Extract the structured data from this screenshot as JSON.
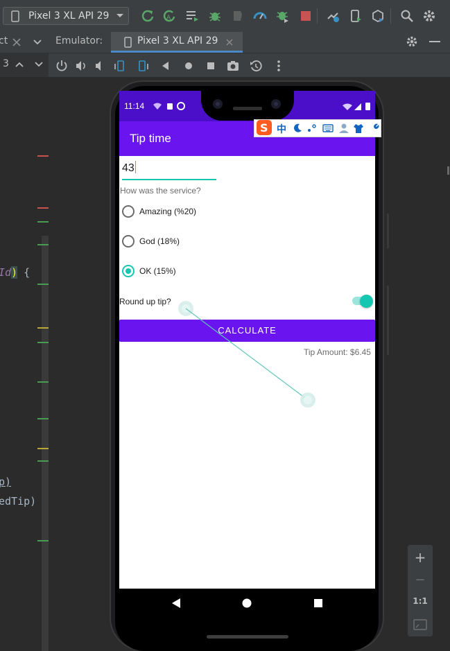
{
  "toolbar": {
    "device_label": "Pixel 3 XL API 29",
    "icons": [
      "device-icon",
      "chevron-down-icon",
      "rerun-icon",
      "apply-changes-icon",
      "apply-code-changes-icon",
      "debug-icon",
      "attach-debugger-icon",
      "profiler-icon",
      "attach-debugger-process-icon",
      "stop-icon",
      "sync-icon",
      "device-manager-icon",
      "sdk-manager-icon",
      "search-icon",
      "settings-icon"
    ],
    "colors": {
      "run_green": "#59a869",
      "stop_red": "#c75450"
    }
  },
  "tabs": {
    "left_partial": "ct",
    "emulator_label": "Emulator:",
    "active_tab": "Pixel 3 XL API 29"
  },
  "controls": {
    "left_partial": "3",
    "icons": [
      "power-icon",
      "volume-up-icon",
      "volume-down-icon",
      "rotate-left-icon",
      "rotate-right-icon",
      "back-icon",
      "home-icon",
      "overview-icon",
      "screenshot-icon",
      "snapshot-icon",
      "more-icon"
    ]
  },
  "editor": {
    "line1": "Id) {",
    "line2": "p)",
    "line3": "edTip)"
  },
  "phone": {
    "status_time": "11:14",
    "app_title": "Tip time",
    "amount_value": "43",
    "service_question": "How was the service?",
    "options": [
      {
        "label": "Amazing (%20)",
        "checked": false
      },
      {
        "label": "God (18%)",
        "checked": false
      },
      {
        "label": "OK (15%)",
        "checked": true
      }
    ],
    "round_up_label": "Round up tip?",
    "round_up_on": true,
    "calculate_label": "CALCULATE",
    "tip_amount": "Tip Amount: $6.45",
    "accent": "#15c7b1",
    "primary": "#6a14ef",
    "status_color": "#4c0fc9"
  },
  "ime": {
    "logo": "S",
    "lang": "中"
  },
  "zoom": {
    "plus": "+",
    "minus": "−",
    "one_to_one": "1:1"
  }
}
